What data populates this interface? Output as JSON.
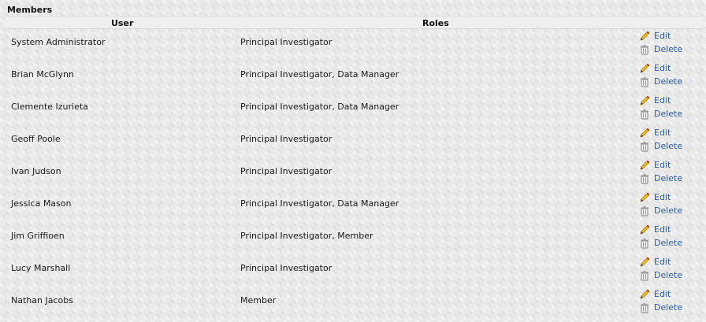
{
  "section": {
    "title": "Members"
  },
  "table": {
    "columns": [
      "User",
      "Roles"
    ],
    "edit_label": "Edit",
    "delete_label": "Delete",
    "rows": [
      {
        "user": "System Administrator",
        "roles": "Principal Investigator"
      },
      {
        "user": "Brian McGlynn",
        "roles": "Principal Investigator, Data Manager"
      },
      {
        "user": "Clemente Izurieta",
        "roles": "Principal Investigator, Data Manager"
      },
      {
        "user": "Geoff Poole",
        "roles": "Principal Investigator"
      },
      {
        "user": "Ivan Judson",
        "roles": "Principal Investigator"
      },
      {
        "user": "Jessica Mason",
        "roles": "Principal Investigator, Data Manager"
      },
      {
        "user": "Jim Griffioen",
        "roles": "Principal Investigator, Member"
      },
      {
        "user": "Lucy Marshall",
        "roles": "Principal Investigator"
      },
      {
        "user": "Nathan Jacobs",
        "roles": "Member"
      }
    ]
  },
  "icons": {
    "edit": "pencil-icon",
    "delete": "trash-icon"
  },
  "colors": {
    "link": "#2e5a9a",
    "header_bg": "#efefef"
  }
}
